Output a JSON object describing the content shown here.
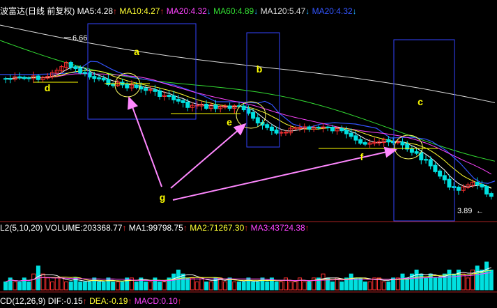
{
  "header_main": {
    "name": "波富达(日线 前复权)",
    "ma": [
      {
        "label": "MA5:4.28",
        "arrow": "↑",
        "color": "#ffffff"
      },
      {
        "label": "MA10:4.27",
        "arrow": "↑",
        "color": "#ffff33"
      },
      {
        "label": "MA20:4.32",
        "arrow": "↓",
        "color": "#ff44ff"
      },
      {
        "label": "MA60:4.89",
        "arrow": "↓",
        "color": "#33dd33"
      },
      {
        "label": "MA120:5.47",
        "arrow": "↓",
        "color": "#dddddd"
      },
      {
        "label": "MA20:4.32",
        "arrow": "↓",
        "color": "#3355ff"
      }
    ]
  },
  "header_volume": {
    "items": [
      {
        "label": "L2(5,10,20) VOLUME:203368.77",
        "arrow": "↑",
        "color": "#ffffff"
      },
      {
        "label": "MA1:99798.75",
        "arrow": "↑",
        "color": "#ffffff"
      },
      {
        "label": "MA2:71267.30",
        "arrow": "↑",
        "color": "#ffff33"
      },
      {
        "label": "MA3:43724.38",
        "arrow": "↑",
        "color": "#ff44ff"
      }
    ]
  },
  "header_macd": {
    "items": [
      {
        "label": "CD(12,26,9) DIF:-0.15",
        "arrow": "↑",
        "color": "#ffffff"
      },
      {
        "label": "DEA:-0.19",
        "arrow": "↑",
        "color": "#ffff33"
      },
      {
        "label": "MACD:0.10",
        "arrow": "↑",
        "color": "#ff44ff"
      }
    ]
  },
  "chart_data": {
    "type": "candlestick",
    "high_label": "6.66",
    "low_label": "3.89",
    "low_arrow": "←",
    "annotations": [
      "a",
      "b",
      "c",
      "d",
      "e",
      "f",
      "g"
    ],
    "colors": {
      "up": "#ff3030",
      "down": "#00e0e0",
      "ma5": "#ffffff",
      "ma10": "#ffff33",
      "ma20": "#ff44ff",
      "ma60": "#33dd33",
      "ma120": "#dddddd",
      "ma20_blue": "#3355ff",
      "annotation_box": "#3344ff",
      "arrow": "#ff88ff",
      "label": "#ffff00",
      "support_line": "#ffff00"
    },
    "volume": [
      2,
      3,
      2,
      2,
      3,
      2,
      4,
      6,
      4,
      3,
      2,
      3,
      3,
      2,
      2,
      3,
      2,
      2,
      2,
      3,
      2,
      2,
      3,
      2,
      2,
      2,
      3,
      3,
      2,
      3,
      2,
      2,
      3,
      2,
      2,
      3,
      4,
      5,
      4,
      3,
      3,
      2,
      3,
      2,
      2,
      3,
      3,
      2,
      3,
      2,
      2,
      2,
      3,
      2,
      2,
      3,
      2,
      3,
      2,
      2,
      3,
      2,
      2,
      3,
      2,
      2,
      3,
      3,
      4,
      3,
      2,
      3,
      2,
      3,
      4,
      3,
      3,
      2,
      2,
      3,
      3,
      2,
      2,
      3,
      3,
      4,
      3,
      4,
      5,
      4,
      3,
      4,
      3,
      3,
      4,
      5,
      4,
      5,
      4,
      3,
      5,
      6,
      5,
      7,
      5
    ]
  }
}
